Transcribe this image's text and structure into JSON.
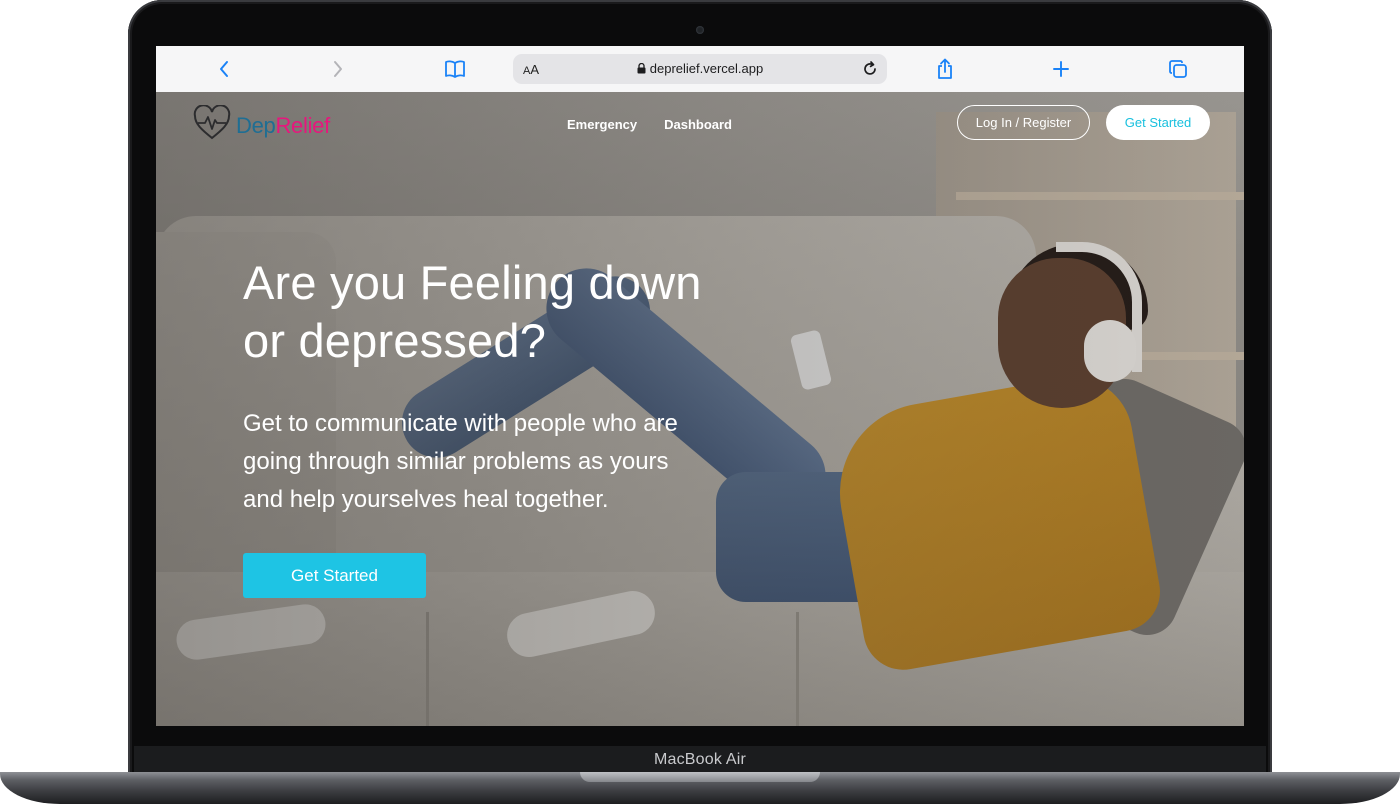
{
  "device": {
    "model_label": "MacBook Air"
  },
  "browser": {
    "text_size_label_small": "A",
    "text_size_label_big": "A",
    "url": "deprelief.vercel.app",
    "icons": {
      "back": "chevron-left-icon",
      "forward": "chevron-right-icon",
      "bookmarks": "book-icon",
      "lock": "lock-icon",
      "reload": "reload-icon",
      "share": "share-icon",
      "new_tab": "plus-icon",
      "tabs": "tabs-icon"
    },
    "accent_color": "#1a82f7"
  },
  "site": {
    "logo": {
      "part1": "Dep",
      "part2": "Relief",
      "icon": "heart-pulse-icon",
      "color_part1": "#1f6e93",
      "color_part2": "#e6177d"
    },
    "nav": {
      "links": [
        "Emergency",
        "Dashboard"
      ],
      "login_label": "Log In / Register",
      "get_started_label": "Get Started"
    },
    "hero": {
      "title_line1": "Are you Feeling down",
      "title_line2": "or depressed?",
      "subtitle_line1": "Get to communicate with people who are",
      "subtitle_line2": "going through similar problems as yours",
      "subtitle_line3": "and help yourselves heal together.",
      "cta_label": "Get Started",
      "cta_color": "#1ec4e4"
    }
  }
}
